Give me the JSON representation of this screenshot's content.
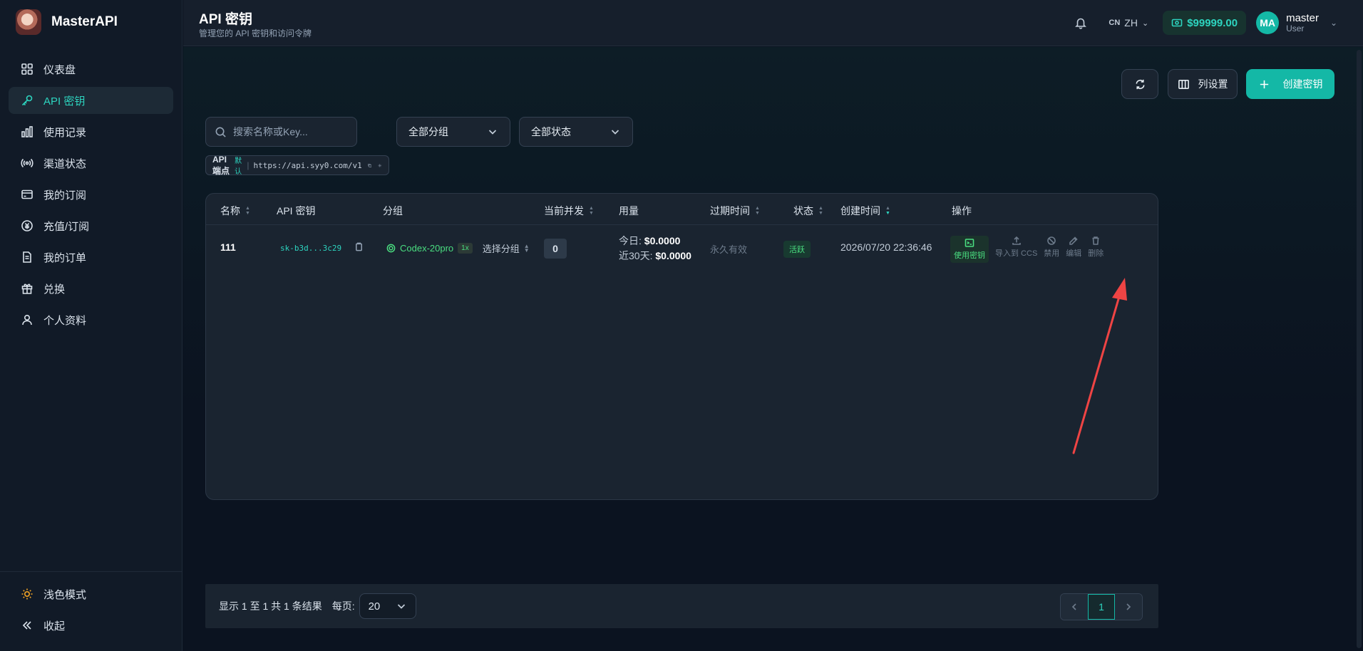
{
  "brand": {
    "name": "MasterAPI"
  },
  "sidebar": {
    "items": [
      {
        "label": "仪表盘",
        "icon": "dashboard-icon"
      },
      {
        "label": "API 密钥",
        "icon": "key-icon",
        "active": true
      },
      {
        "label": "使用记录",
        "icon": "bar-chart-icon"
      },
      {
        "label": "渠道状态",
        "icon": "broadcast-icon"
      },
      {
        "label": "我的订阅",
        "icon": "card-icon"
      },
      {
        "label": "充值/订阅",
        "icon": "currency-icon"
      },
      {
        "label": "我的订单",
        "icon": "document-icon"
      },
      {
        "label": "兑换",
        "icon": "gift-icon"
      },
      {
        "label": "个人资料",
        "icon": "user-icon"
      }
    ],
    "theme_toggle": "浅色模式",
    "collapse": "收起"
  },
  "header": {
    "title": "API 密钥",
    "subtitle": "管理您的 API 密钥和访问令牌",
    "lang_flag": "CN",
    "lang": "ZH",
    "balance": "$99999.00",
    "user": {
      "initials": "MA",
      "name": "master",
      "role": "User"
    }
  },
  "toolbar": {
    "column_settings": "列设置",
    "create_key": "创建密钥"
  },
  "filters": {
    "search_placeholder": "搜索名称或Key...",
    "group_select": "全部分组",
    "status_select": "全部状态"
  },
  "endpoint": {
    "label": "API 端点",
    "default_badge": "默认",
    "url": "https://api.syy0.com/v1"
  },
  "table": {
    "headers": {
      "name": "名称",
      "key": "API 密钥",
      "group": "分组",
      "concurrency": "当前并发",
      "usage": "用量",
      "expires": "过期时间",
      "status": "状态",
      "created": "创建时间",
      "actions": "操作"
    },
    "rows": [
      {
        "name": "111",
        "key": "sk-b3d...3c29",
        "group": "Codex-20pro",
        "multiplier": "1x",
        "choose_group": "选择分组",
        "concurrency": "0",
        "today_label": "今日:",
        "today": "$0.0000",
        "month_label": "近30天:",
        "month": "$0.0000",
        "expires": "永久有效",
        "status": "活跃",
        "created": "2026/07/20 22:36:46",
        "actions": {
          "use_key": "使用密钥",
          "import_ccs": "导入到 CCS",
          "disable": "禁用",
          "edit": "编辑",
          "delete": "删除"
        }
      }
    ]
  },
  "footer": {
    "summary": "显示 1 至 1 共 1 条结果",
    "per_page_label": "每页:",
    "per_page": "20",
    "current_page": "1"
  },
  "colors": {
    "accent": "#14b8a6",
    "success": "#4ade80",
    "annotation_arrow": "#ef4444"
  }
}
